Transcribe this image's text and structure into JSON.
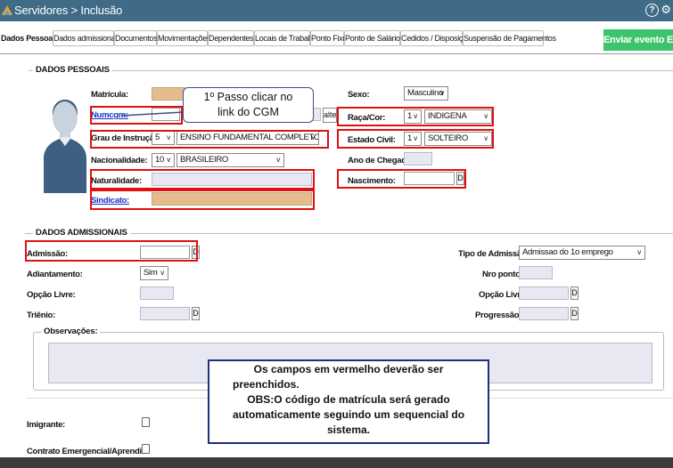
{
  "window": {
    "title": "Servidores > Inclusão",
    "help_label": "?",
    "settings_label": "⚙"
  },
  "tabs": [
    "Dados Pessoais",
    "Dados admissionais",
    "Documentos",
    "Movimentações",
    "Dependentes",
    "Locais de Trabalho",
    "Ponto Fixo",
    "Ponto de Salário",
    "Cedidos / Disposição",
    "Suspensão de Pagamentos"
  ],
  "enviar_button": "Enviar evento Es",
  "dados_pessoais": {
    "legend": "DADOS PESSOAIS",
    "matricula_label": "Matrícula:",
    "numcgm_label": "Numcgm:",
    "alterar_label": "alterar",
    "grau_label": "Grau de Instrução:",
    "grau_code": "5",
    "grau_value": "ENSINO FUNDAMENTAL COMPLETO",
    "nacionalidade_label": "Nacionalidade:",
    "nacionalidade_code": "10",
    "nacionalidade_value": "BRASILEIRO",
    "naturalidade_label": "Naturalidade:",
    "sindicato_label": "Sindicato:",
    "sexo_label": "Sexo:",
    "sexo_value": "Masculino",
    "raca_label": "Raça/Cor:",
    "raca_code": "1",
    "raca_value": "INDIGENA",
    "estado_civil_label": "Estado Civil:",
    "estado_civil_code": "1",
    "estado_civil_value": "SOLTEIRO",
    "ano_chegada_label": "Ano de Chegada:",
    "nascimento_label": "Nascimento:",
    "date_button": "D"
  },
  "callout": {
    "line1": "1º Passo clicar no",
    "line2": "link do CGM"
  },
  "dados_admissionais": {
    "legend": "DADOS ADMISSIONAIS",
    "admissao_label": "Admissão:",
    "adiantamento_label": "Adiantamento:",
    "adiantamento_value": "Sim",
    "opcao_livre_label": "Opção Livre:",
    "trienio_label": "Triênio:",
    "tipo_admissao_label": "Tipo de Admissão:",
    "tipo_admissao_value": "Admissao do 1o emprego",
    "nro_ponto_label": "Nro ponto:",
    "opcao_livre2_label": "Opção Livre:",
    "progressao_label": "Progressão:",
    "observacoes_label": "Observações:",
    "imigrante_label": "Imigrante:",
    "contrato_label": "Contrato Emergencial/Aprendiz:"
  },
  "note": {
    "line1": "Os campos em vermelho deverão ser",
    "line2": "preenchidos.",
    "line3": "OBS:O código de matrícula será gerado",
    "line4": "automaticamente seguindo um sequencial do",
    "line5": "sistema."
  },
  "colors": {
    "titlebar": "#3f6b87",
    "required_outline": "#e01010",
    "enviar": "#3cc46b"
  }
}
